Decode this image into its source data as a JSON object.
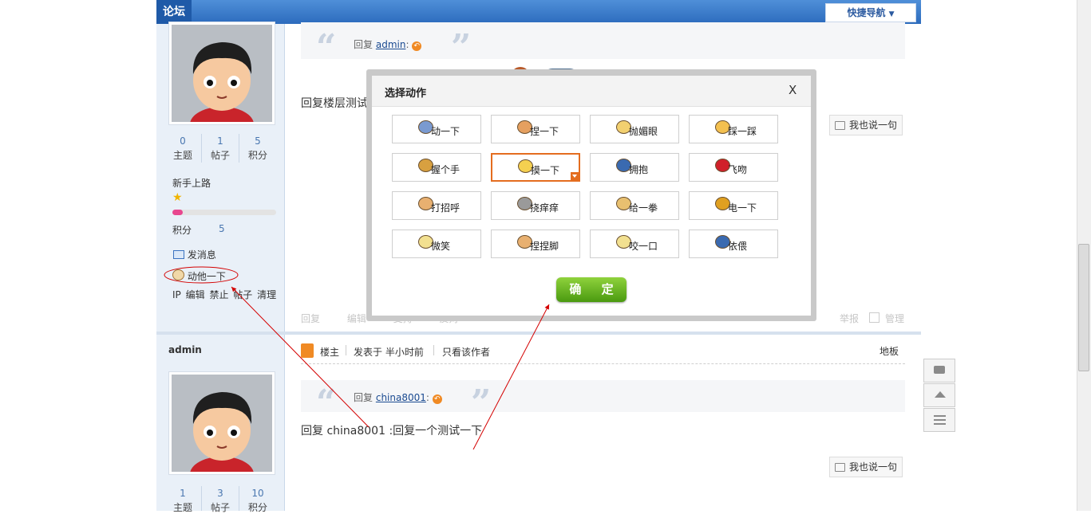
{
  "header": {
    "forum_tab": "论坛",
    "quick_nav": "快捷导航"
  },
  "post1": {
    "stats": [
      {
        "num": "0",
        "label": "主题"
      },
      {
        "num": "1",
        "label": "帖子"
      },
      {
        "num": "5",
        "label": "积分"
      }
    ],
    "rank": "新手上路",
    "points_label": "积分",
    "points_value": "5",
    "send_message": "发消息",
    "poke": "动他一下",
    "admin_links": [
      "IP",
      "编辑",
      "禁止",
      "帖子",
      "清理"
    ],
    "quote_prefix": "回复",
    "quote_user": "admin",
    "quote_suffix": ":",
    "body_text": "回复楼层测试回",
    "say_button": "我也说一句",
    "footer_actions": [
      "回复",
      "编辑",
      "支持",
      "反对"
    ],
    "footer_right": [
      "举报",
      "管理"
    ]
  },
  "post2": {
    "author": "admin",
    "louzhu": "楼主",
    "posted": "发表于 半小时前",
    "only_author": "只看该作者",
    "floor": "地板",
    "quote_prefix": "回复",
    "quote_user": "china8001",
    "quote_suffix": ":",
    "body_text": "回复 china8001 :回复一个测试一下",
    "say_button": "我也说一句",
    "stats": [
      {
        "num": "1",
        "label": "主题"
      },
      {
        "num": "3",
        "label": "帖子"
      },
      {
        "num": "10",
        "label": "积分"
      }
    ]
  },
  "dialog": {
    "title": "选择动作",
    "close": "X",
    "confirm": "确 定",
    "actions": [
      {
        "label": "动一下",
        "icon": "poke-icon"
      },
      {
        "label": "捏一下",
        "icon": "pinch-icon"
      },
      {
        "label": "抛媚眼",
        "icon": "wink-icon"
      },
      {
        "label": "踩一踩",
        "icon": "step-icon"
      },
      {
        "label": "握个手",
        "icon": "handshake-icon"
      },
      {
        "label": "摸一下",
        "icon": "touch-icon"
      },
      {
        "label": "拥抱",
        "icon": "hug-icon"
      },
      {
        "label": "飞吻",
        "icon": "kiss-icon"
      },
      {
        "label": "打招呼",
        "icon": "wave-icon"
      },
      {
        "label": "挠痒痒",
        "icon": "tickle-icon"
      },
      {
        "label": "给一拳",
        "icon": "punch-icon"
      },
      {
        "label": "电一下",
        "icon": "shock-icon"
      },
      {
        "label": "微笑",
        "icon": "smile-icon"
      },
      {
        "label": "捏捏脚",
        "icon": "foot-icon"
      },
      {
        "label": "咬一口",
        "icon": "bite-icon"
      },
      {
        "label": "依偎",
        "icon": "cuddle-icon"
      }
    ],
    "selected_index": 5
  },
  "colors": {
    "header_blue": "#2c6bbd",
    "sidebar_bg": "#e9f0f8",
    "selected_border": "#e46d1f",
    "confirm_green": "#5aa918",
    "annotation_red": "#d40000"
  }
}
